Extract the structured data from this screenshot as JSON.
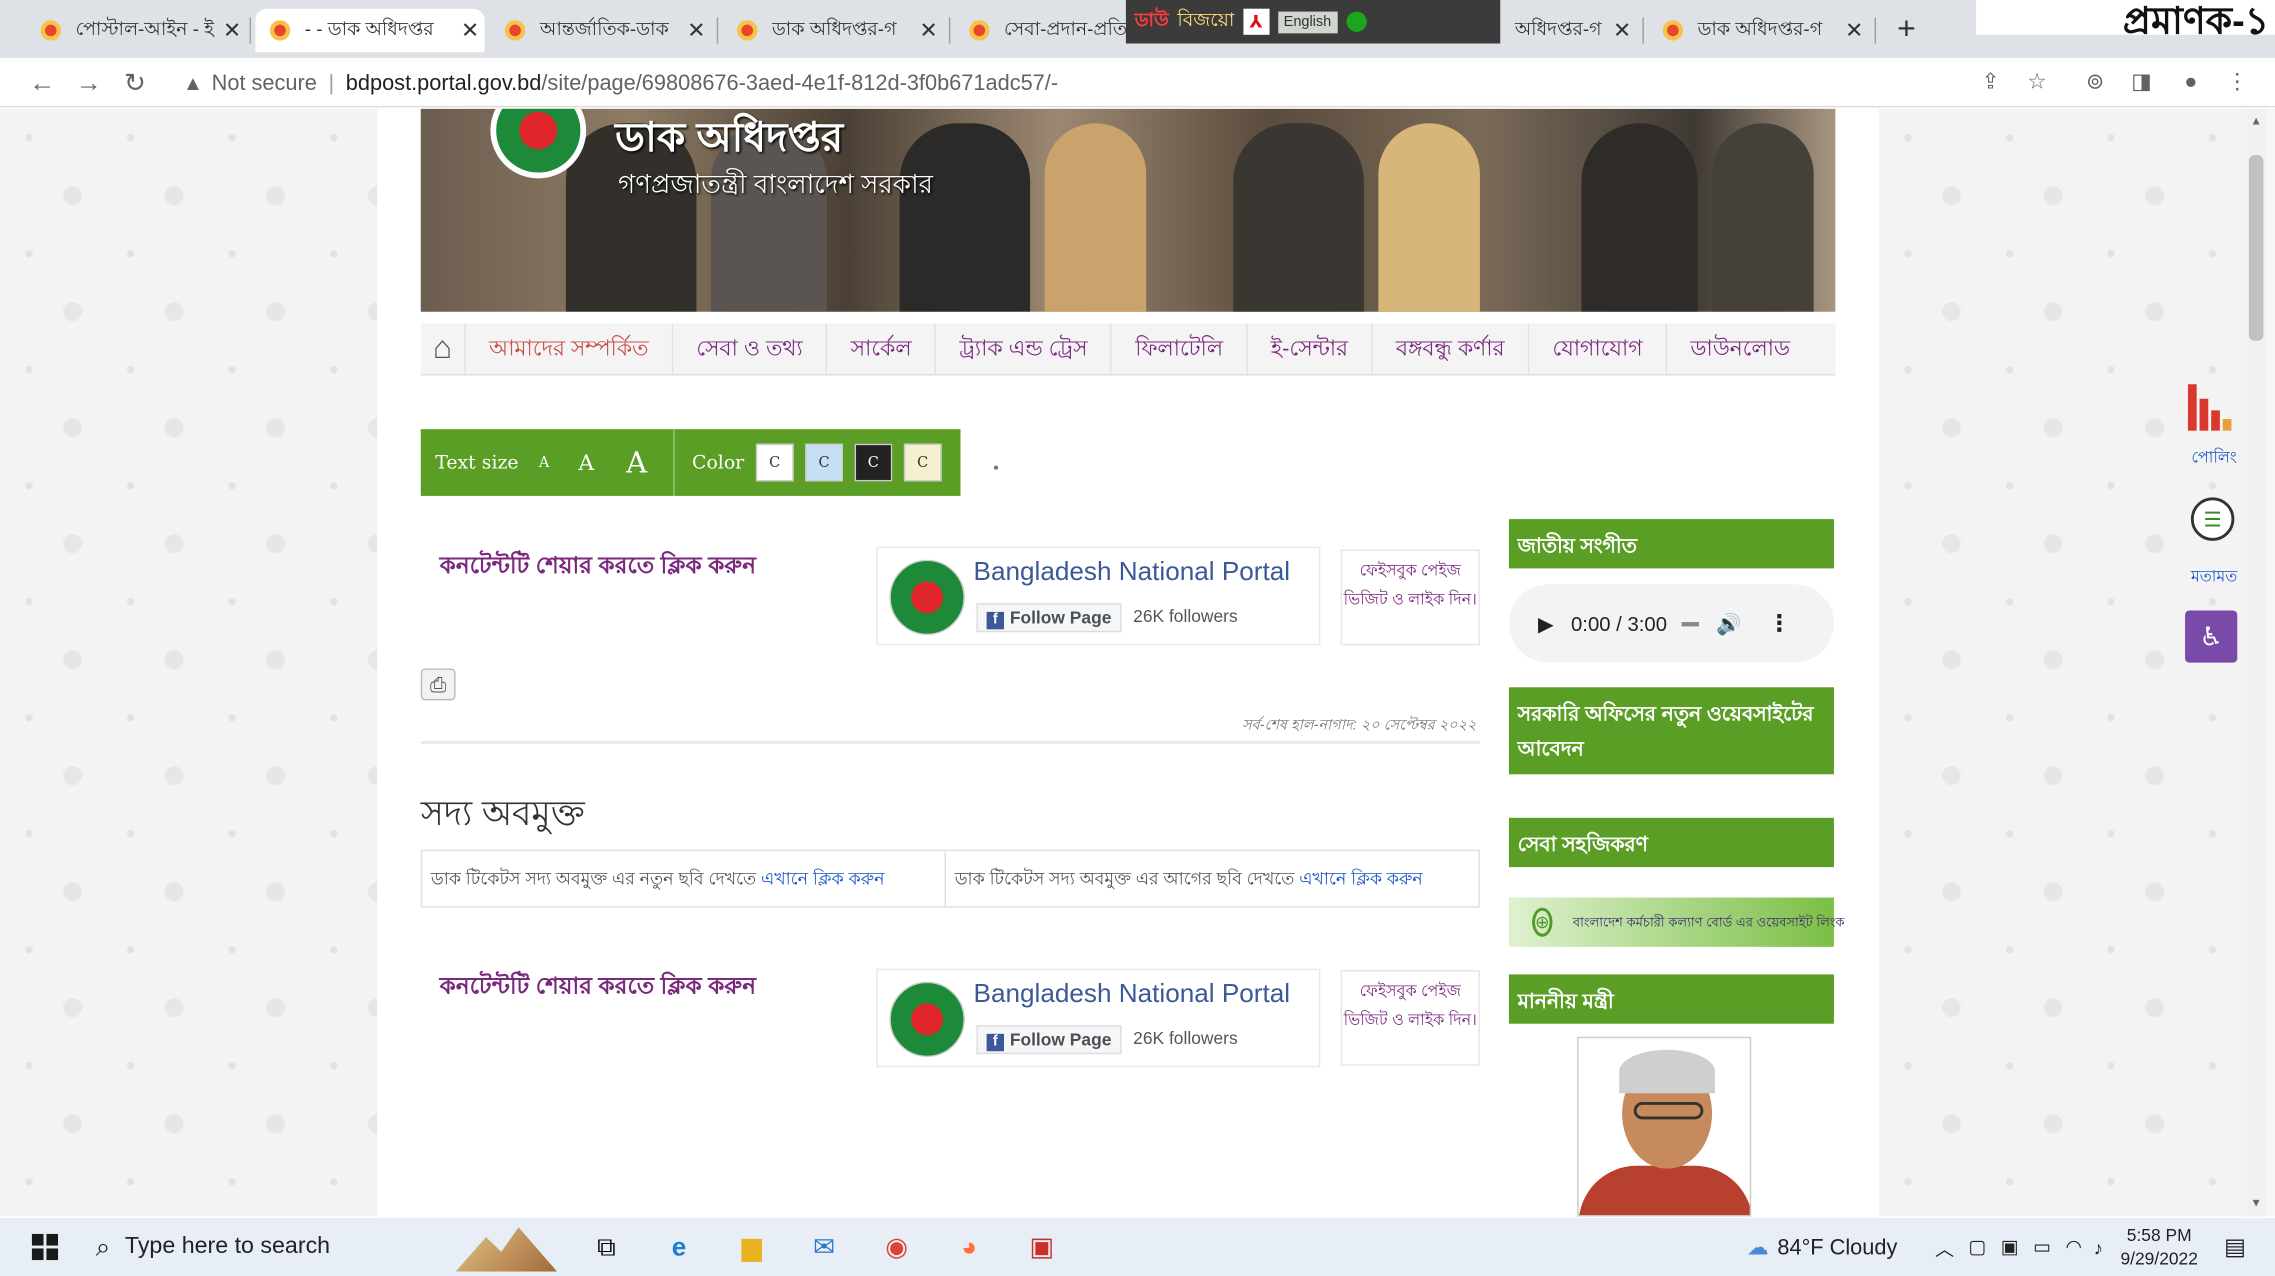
{
  "corner_label": "প্রমাণক-১",
  "browser": {
    "tabs": [
      {
        "title": "পোস্টাল-আইন - ই",
        "active": false
      },
      {
        "title": "- - ডাক অধিদপ্তর",
        "active": true
      },
      {
        "title": "আন্তর্জাতিক-ডাক",
        "active": false
      },
      {
        "title": "ডাক অধিদপ্তর-গ",
        "active": false
      },
      {
        "title": "সেবা-প্রদান-প্রতি",
        "active": false
      },
      {
        "title": "অধিদপ্তর-গ",
        "active": false
      },
      {
        "title": "ডাক অধিদপ্তর-গ",
        "active": false
      }
    ],
    "ime_bar": {
      "download": "ডাউ",
      "bijoy": "বিজয়ো",
      "english": "English"
    },
    "security": "Not secure",
    "url_host": "bdpost.portal.gov.bd",
    "url_path": "/site/page/69808676-3aed-4e1f-812d-3f0b671adc57/-"
  },
  "header": {
    "title": "ডাক অধিদপ্তর",
    "subtitle": "গণপ্রজাতন্ত্রী বাংলাদেশ সরকার"
  },
  "nav": {
    "items": [
      "আমাদের সম্পর্কিত",
      "সেবা ও তথ্য",
      "সার্কেল",
      "ট্র্যাক এন্ড ট্রেস",
      "ফিলাটেলি",
      "ই-সেন্টার",
      "বঙ্গবন্ধু কর্ণার",
      "যোগাযোগ",
      "ডাউনলোড"
    ]
  },
  "accessibility": {
    "text_size_label": "Text size",
    "size_small": "A",
    "size_medium": "A",
    "size_large": "A",
    "color_label": "Color",
    "swatches": [
      {
        "label": "C",
        "bg": "#ffffff",
        "fg": "#333333"
      },
      {
        "label": "C",
        "bg": "#c7dff5",
        "fg": "#333333"
      },
      {
        "label": "C",
        "bg": "#222222",
        "fg": "#ffffff"
      },
      {
        "label": "C",
        "bg": "#f6efd0",
        "fg": "#333333"
      }
    ]
  },
  "share_block_1": {
    "share_text": "কনটেন্টটি শেয়ার করতে ক্লিক করুন",
    "fb_name": "Bangladesh National Portal",
    "follow": "Follow Page",
    "followers": "26K followers",
    "fb_note": "ফেইসবুক পেইজ ভিজিট ও লাইক দিন।"
  },
  "last_updated": "সর্ব-শেষ হাল-নাগাদ: ২০ সেপ্টেম্বর ২০২২",
  "section": {
    "heading": "সদ্য অবমুক্ত",
    "cell1_text": "ডাক টিকেটস সদ্য অবমুক্ত এর নতুন ছবি দেখতে",
    "cell1_link": "এখানে ক্লিক করুন",
    "cell2_text": "ডাক টিকেটস সদ্য অবমুক্ত এর আগের ছবি দেখতে",
    "cell2_link": "এখানে ক্লিক করুন"
  },
  "share_block_2": {
    "share_text": "কনটেন্টটি শেয়ার করতে ক্লিক করুন",
    "fb_name": "Bangladesh National Portal",
    "follow": "Follow Page",
    "followers": "26K followers",
    "fb_note": "ফেইসবুক পেইজ ভিজিট ও লাইক দিন।"
  },
  "sidebar": {
    "anthem": "জাতীয় সংগীত",
    "audio_time": "0:00 / 3:00",
    "new_site": "সরকারি অফিসের নতুন ওয়েবসাইটের আবেদন",
    "service": "সেবা সহজিকরণ",
    "banner_text": "বাংলাদেশ কর্মচারী কল্যাণ বোর্ড এর ওয়েবসাইট লিংক",
    "minister": "মাননীয় মন্ত্রী"
  },
  "right_tools": {
    "poll": "পোলিং",
    "feedback": "মতামত"
  },
  "taskbar": {
    "search": "Type here to search",
    "weather": "84°F  Cloudy",
    "time": "5:58 PM",
    "date": "9/29/2022"
  },
  "colors": {
    "green": "#5a9e25",
    "purple_text": "#7a2a7e",
    "link_blue": "#1a55c4",
    "fb_blue": "#3b5998"
  }
}
